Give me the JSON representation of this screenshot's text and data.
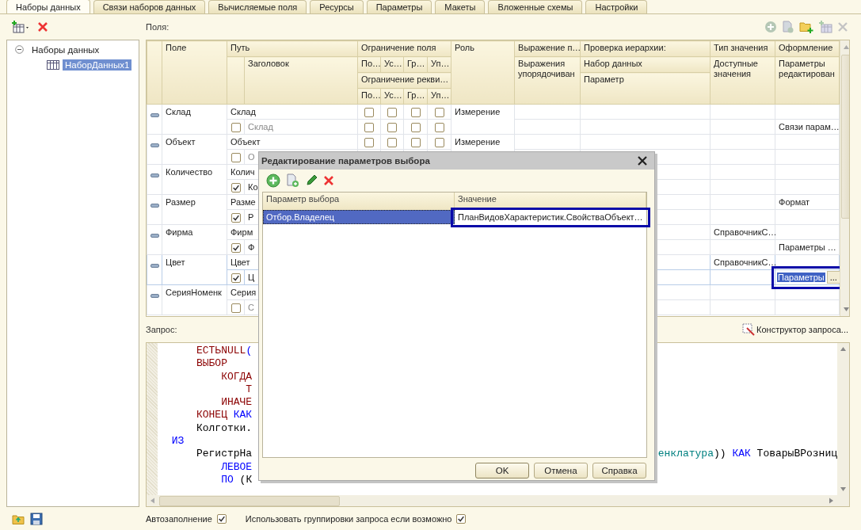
{
  "tabs": [
    {
      "label": "Наборы данных",
      "selected": true
    },
    {
      "label": "Связи наборов данных",
      "selected": false
    },
    {
      "label": "Вычисляемые поля",
      "selected": false
    },
    {
      "label": "Ресурсы",
      "selected": false
    },
    {
      "label": "Параметры",
      "selected": false
    },
    {
      "label": "Макеты",
      "selected": false
    },
    {
      "label": "Вложенные схемы",
      "selected": false
    },
    {
      "label": "Настройки",
      "selected": false
    }
  ],
  "tree": {
    "label": "Наборы данных",
    "expanded": true,
    "children": [
      {
        "label": "НаборДанных1",
        "selected": true
      }
    ]
  },
  "fields": {
    "label": "Поля:",
    "header": {
      "field": "Поле",
      "path": "Путь",
      "title": "Заголовок",
      "field_restriction": "Ограничение поля",
      "restriction_columns": [
        "По…",
        "Ус…",
        "Гр…",
        "Уп…"
      ],
      "attribute_restriction": "Ограничение рекви…",
      "attribute_restriction_columns": [
        "По…",
        "Ус…",
        "Гр…",
        "Уп…"
      ],
      "role": "Роль",
      "expression": "Выражение п…",
      "order_expressions": "Выражения упорядочиван",
      "hierarchy_check": "Проверка иерархии:",
      "data_set": "Набор данных",
      "parameter": "Параметр",
      "value_type": "Тип значения",
      "available_values": "Доступные значения",
      "appearance": "Оформление",
      "edit_parameters": "Параметры редактирован"
    },
    "rows": [
      {
        "field": "Склад",
        "path": "Склад",
        "title": "Склад",
        "title_used": false,
        "field_restrictions": [
          false,
          false,
          false,
          false
        ],
        "attribute_restrictions": [
          false,
          false,
          false,
          false
        ],
        "role": "Измерение",
        "appearance_params": "Связи парам…",
        "selected": false
      },
      {
        "field": "Объект",
        "path": "Объект",
        "title": "О",
        "title_used": false,
        "field_restrictions": [
          false,
          false,
          false,
          false
        ],
        "role": "Измерение",
        "selected": false
      },
      {
        "field": "Количество",
        "path": "Колич",
        "title": "Ко",
        "title_used": true,
        "selected": false
      },
      {
        "field": "Размер",
        "path": "Разме",
        "title": "Р",
        "title_used": true,
        "appearance": "Формат",
        "selected": false
      },
      {
        "field": "Фирма",
        "path": "Фирм",
        "title": "Ф",
        "title_used": true,
        "value_type": "СправочникС…",
        "appearance_params": "Параметры …",
        "selected": false
      },
      {
        "field": "Цвет",
        "path": "Цвет",
        "title": "Ц",
        "title_used": true,
        "value_type": "СправочникС…",
        "editor": {
          "value": "Параметры",
          "button": "...",
          "highlighted": true
        },
        "selected": true
      },
      {
        "field": "СерияНоменк",
        "path": "Серия",
        "title": "С",
        "title_used": false,
        "selected": false
      }
    ]
  },
  "query": {
    "label": "Запрос:",
    "constructor_button": "Конструктор запроса...",
    "lines": [
      {
        "tokens": [
          {
            "kind": "function",
            "text": "    ЕСТЬNULL"
          },
          {
            "kind": "keyword",
            "text": "("
          }
        ]
      },
      {
        "tokens": [
          {
            "kind": "function",
            "text": "    ВЫБОР"
          }
        ]
      },
      {
        "tokens": [
          {
            "kind": "function",
            "text": "        КОГДА"
          }
        ]
      },
      {
        "tokens": [
          {
            "kind": "function",
            "text": "            Т"
          }
        ]
      },
      {
        "tokens": [
          {
            "kind": "function",
            "text": "        ИНАЧЕ"
          }
        ]
      },
      {
        "tokens": [
          {
            "kind": "function",
            "text": "    КОНЕЦ "
          },
          {
            "kind": "keyword",
            "text": "КАК"
          }
        ]
      },
      {
        "tokens": [
          {
            "kind": "text",
            "text": "    Колготки."
          }
        ]
      },
      {
        "tokens": [
          {
            "kind": "keyword",
            "text": "ИЗ"
          }
        ]
      },
      {
        "tokens": [
          {
            "kind": "text",
            "text": "    РегистрНа"
          }
        ],
        "continuation": [
          {
            "kind": "name",
            "text": "енклатура"
          },
          {
            "kind": "text",
            "text": ")) "
          },
          {
            "kind": "keyword",
            "text": "КАК"
          },
          {
            "kind": "text",
            "text": " ТоварыВРозниц"
          }
        ]
      },
      {
        "tokens": [
          {
            "kind": "keyword",
            "text": "        ЛЕВОЕ"
          }
        ]
      },
      {
        "tokens": [
          {
            "kind": "keyword",
            "text": "        ПО "
          },
          {
            "kind": "text",
            "text": "(К"
          }
        ]
      }
    ]
  },
  "options": [
    {
      "label": "Автозаполнение",
      "checked": true
    },
    {
      "label": "Использовать группировки запроса если возможно",
      "checked": true
    }
  ],
  "dialog": {
    "title": "Редактирование параметров выбора",
    "columns": [
      "Параметр выбора",
      "Значение"
    ],
    "rows": [
      {
        "parameter": "Отбор.Владелец",
        "value": "ПланВидовХарактеристик.СвойстваОбъект…",
        "selected": true,
        "highlighted": true
      }
    ],
    "buttons": [
      "OK",
      "Отмена",
      "Справка"
    ]
  }
}
